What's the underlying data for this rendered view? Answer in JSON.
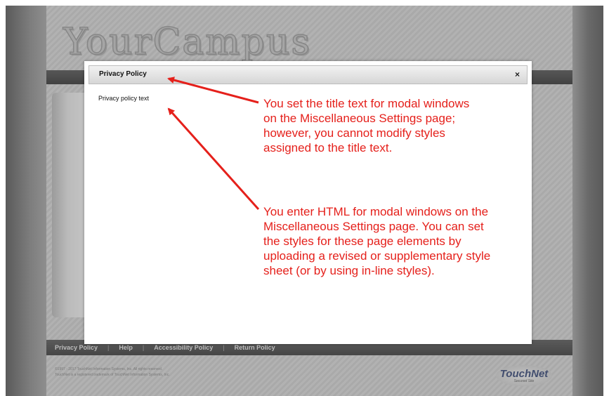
{
  "site": {
    "logo_text": "YourCampus"
  },
  "footer": {
    "links": [
      "Privacy Policy",
      "Help",
      "Accessibility Policy",
      "Return Policy"
    ],
    "copyright_lines": [
      "©1997 - 2017 TouchNet Information Systems, Inc. All rights reserved.",
      "TouchNet is a registered trademark of TouchNet Information Systems, Inc."
    ],
    "brand": {
      "name": "TouchNet",
      "tagline": "Secured Site"
    }
  },
  "modal": {
    "title": "Privacy Policy",
    "close_glyph": "×",
    "body_text": "Privacy policy text"
  },
  "annotations": {
    "title_note": "You set the title text for modal windows on the Miscellaneous Settings page; however, you cannot modify styles assigned to the title text.",
    "body_note": "You enter HTML for modal windows on the Miscellaneous Settings page. You can set the styles for these page elements by uploading a revised or supplementary style sheet (or by using in-line styles).",
    "color": "#e5201b"
  }
}
